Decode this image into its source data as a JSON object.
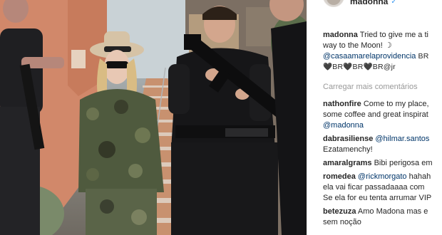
{
  "post": {
    "author": "madonna",
    "verified_mark": "✓",
    "caption": {
      "username": "madonna",
      "line1": "Tried to give me a ti",
      "line2": "way to the Moon! ☽",
      "mention": "@casaamarelaprovidencia",
      "mention_suffix": " BR",
      "tags": "🖤BR🖤BR🖤BR@jr"
    },
    "load_more": "Carregar mais comentários"
  },
  "comments": [
    {
      "username": "nathonfire",
      "lines": [
        "Come to my place,",
        "some coffee and great inspirat",
        "@madonna"
      ]
    },
    {
      "username": "dabrasiliense",
      "mention": "@hilmar.santos",
      "lines": [
        "Ezatamenchy!"
      ]
    },
    {
      "username": "amaralgrams",
      "lines": [
        "Bibi perigosa em"
      ]
    },
    {
      "username": "romedea",
      "mention": "@rickmorgato",
      "text": " hahah",
      "lines": [
        "ela vai ficar passadaaaa com",
        "Se ela for eu tenta arrumar VIP"
      ]
    },
    {
      "username": "betezuza",
      "lines": [
        "Amo Madona mas e",
        "sem noção"
      ]
    }
  ],
  "colors": {
    "link": "#003569",
    "muted": "#999999",
    "text": "#262626",
    "verified": "#3897f0"
  },
  "icons": [
    "verified-badge-icon",
    "moon-emoji-icon",
    "heart-icon"
  ]
}
